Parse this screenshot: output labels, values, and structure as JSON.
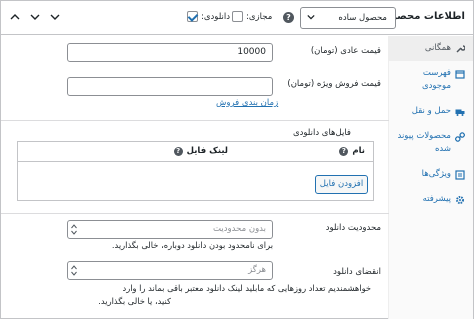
{
  "header": {
    "title": "اطلاعات محصول —",
    "product_type": "محصول ساده",
    "virtual_label": "مجازی:",
    "downloadable_label": "دانلودی:",
    "virtual_checked": false,
    "downloadable_checked": true
  },
  "tabs": [
    {
      "label": "همگانی",
      "icon": "wrench-icon",
      "active": true
    },
    {
      "label": "فهرست موجودی",
      "icon": "inventory-icon",
      "active": false
    },
    {
      "label": "حمل و نقل",
      "icon": "truck-icon",
      "active": false
    },
    {
      "label": "محصولات پیوند شده",
      "icon": "link-icon",
      "active": false
    },
    {
      "label": "ویژگی‌ها",
      "icon": "list-icon",
      "active": false
    },
    {
      "label": "پیشرفته",
      "icon": "gear-icon",
      "active": false
    }
  ],
  "general": {
    "regular_price_label": "قیمت عادی (تومان)",
    "regular_price_value": "10000",
    "sale_price_label": "قیمت فروش ویژه (تومان)",
    "sale_price_value": "",
    "schedule_link": "زمان بندی فروش"
  },
  "downloads": {
    "section_label": "فایل‌های دانلودی",
    "col_name": "نام",
    "col_link": "لینک فایل",
    "add_button": "افزودن فایل"
  },
  "download_limit": {
    "label": "محدودیت دانلود",
    "placeholder": "بدون محدودیت",
    "help": "برای نامحدود بودن دانلود دوباره، خالی بگذارید."
  },
  "download_expiry": {
    "label": "انقضای دانلود",
    "placeholder": "هرگز",
    "help_line1": "خواهشمندیم تعداد روزهایی که مابلید لینک دانلود معتبر باقی بماند را وارد",
    "help_line2": "کنید، یا خالی بگذارید."
  },
  "colors": {
    "accent": "#2271b1",
    "border": "#c3c4c7"
  }
}
